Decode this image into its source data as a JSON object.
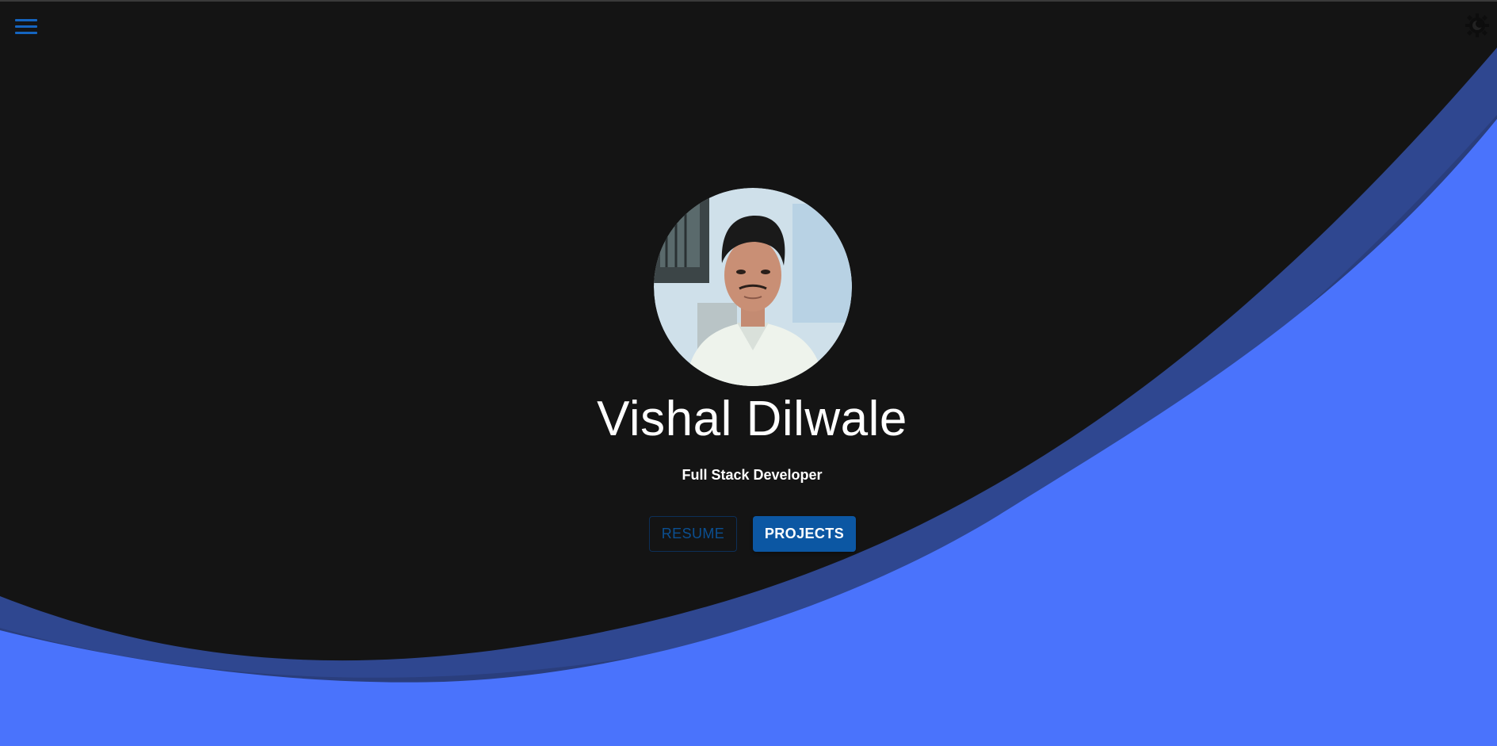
{
  "header": {
    "menu_icon": "hamburger-menu-icon",
    "theme_icon": "dark-mode-toggle-icon"
  },
  "hero": {
    "name": "Vishal Dilwale",
    "role": "Full Stack Developer",
    "avatar_alt": "profile-photo",
    "buttons": {
      "resume_label": "RESUME",
      "projects_label": "PROJECTS"
    }
  },
  "colors": {
    "background": "#141414",
    "wave_dark": "#2e478e",
    "wave_light": "#4a73fc",
    "accent": "#0c57a3",
    "text": "#ffffff"
  }
}
